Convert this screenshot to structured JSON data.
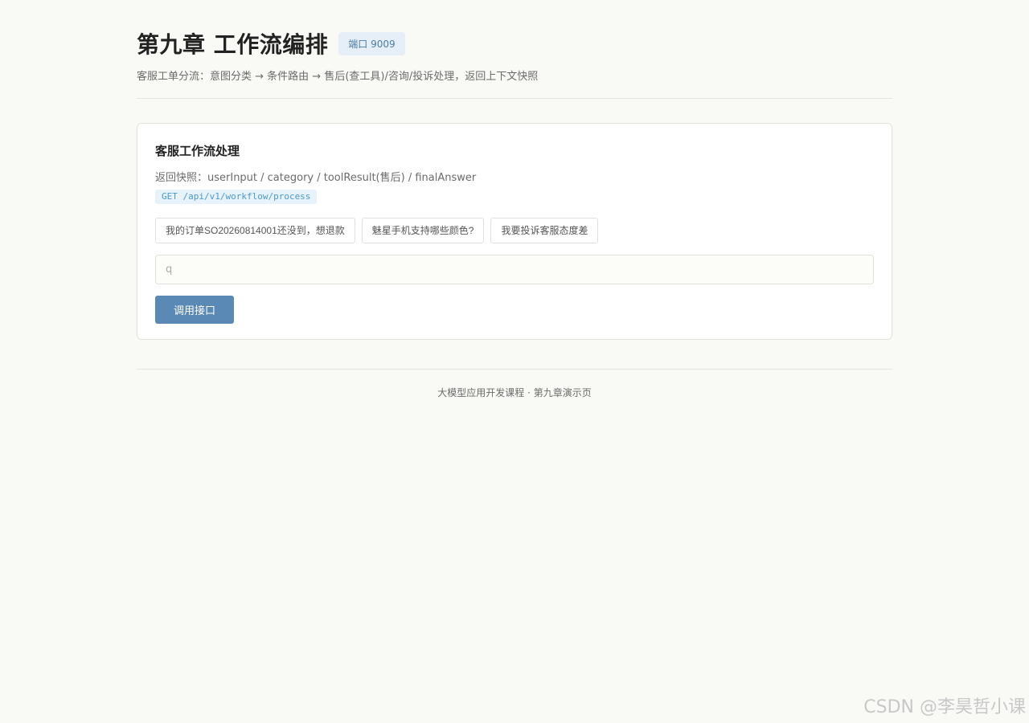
{
  "header": {
    "title": "第九章 工作流编排",
    "port_badge": "端口 9009",
    "subtitle": "客服工单分流：意图分类 → 条件路由 → 售后(查工具)/咨询/投诉处理，返回上下文快照"
  },
  "card": {
    "title": "客服工作流处理",
    "snapshot_desc": "返回快照：userInput / category / toolResult(售后) / finalAnswer",
    "endpoint": "GET /api/v1/workflow/process",
    "examples": [
      "我的订单SO20260814001还没到，想退款",
      "魅星手机支持哪些颜色?",
      "我要投诉客服态度差"
    ],
    "input": {
      "placeholder": "q",
      "value": ""
    },
    "call_button_label": "调用接口"
  },
  "footer": {
    "text": "大模型应用开发课程 · 第九章演示页"
  },
  "watermark": "CSDN @李昊哲小课",
  "colors": {
    "background": "#f9f9f6",
    "accent_button": "#5b89b5",
    "badge_bg": "#e6eff7",
    "badge_text": "#4a7ba7",
    "endpoint_text": "#4a9ac9"
  }
}
